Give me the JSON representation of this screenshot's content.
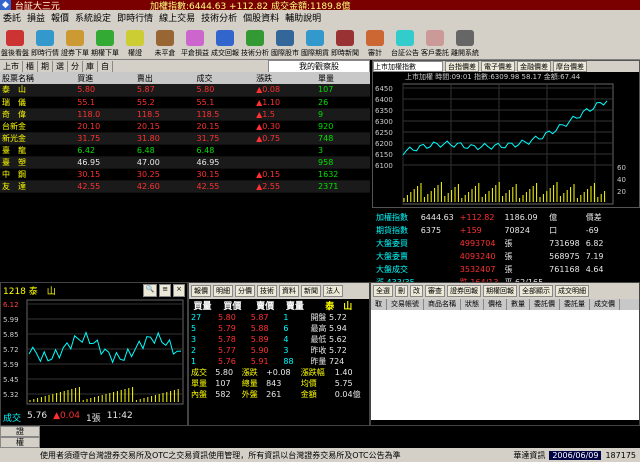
{
  "app": {
    "title": "台証大三元",
    "index_line": "加權指數:6444.63  +112.82 成交金額:1189.8億"
  },
  "menu": [
    "委託",
    "損益",
    "報價",
    "系統設定",
    "即時行情",
    "線上交易",
    "技術分析",
    "個股資料",
    "輔助說明"
  ],
  "toolbar": [
    "盤後看盤",
    "即時行情",
    "證券下單",
    "期權下單",
    "權證",
    "未平倉",
    "平倉損益",
    "成交回報",
    "技術分析",
    "國際股市",
    "國際期貨",
    "即時新聞",
    "審計",
    "台証公告",
    "客戶委託",
    "離開系統"
  ],
  "watch_tabs": [
    "上市",
    "櫃",
    "期",
    "選",
    "分",
    "庫",
    "自"
  ],
  "watchlist_title": "我的觀察股",
  "watch": {
    "headers": [
      "股票名稱",
      "買進",
      "賣出",
      "成交",
      "漲跌",
      "單量"
    ],
    "rows": [
      {
        "name": "泰　山",
        "bid": "5.80",
        "ask": "5.87",
        "last": "5.80",
        "chg": "▲0.08",
        "vol": "107",
        "c": "red"
      },
      {
        "name": "瑞　儀",
        "bid": "55.1",
        "ask": "55.2",
        "last": "55.1",
        "chg": "▲1.10",
        "vol": "26",
        "c": "red"
      },
      {
        "name": "奇　偉",
        "bid": "118.0",
        "ask": "118.5",
        "last": "118.5",
        "chg": "▲1.5",
        "vol": "9",
        "c": "red"
      },
      {
        "name": "台新金",
        "bid": "20.10",
        "ask": "20.15",
        "last": "20.15",
        "chg": "▲0.30",
        "vol": "920",
        "c": "red"
      },
      {
        "name": "新光金",
        "bid": "31.75",
        "ask": "31.80",
        "last": "31.75",
        "chg": "▲0.75",
        "vol": "748",
        "c": "red"
      },
      {
        "name": "臺　龍",
        "bid": "6.42",
        "ask": "6.48",
        "last": "6.48",
        "chg": "",
        "vol": "3",
        "c": "grn"
      },
      {
        "name": "臺　塑",
        "bid": "46.95",
        "ask": "47.00",
        "last": "46.95",
        "chg": "",
        "vol": "958",
        "c": "wht"
      },
      {
        "name": "中　鋼",
        "bid": "30.15",
        "ask": "30.25",
        "last": "30.15",
        "chg": "▲0.15",
        "vol": "1632",
        "c": "red"
      },
      {
        "name": "友　達",
        "bid": "42.55",
        "ask": "42.60",
        "last": "42.55",
        "chg": "▲2.55",
        "vol": "2371",
        "c": "red"
      }
    ]
  },
  "chart": {
    "selector": "上市加權指數",
    "tabs": [
      "台指價差",
      "電子價差",
      "金融價差",
      "摩台價差"
    ],
    "info": "上市加權  時間:09:01 指數:6309.98 58.17 金額:67.44",
    "y_ticks": [
      "6450",
      "6400",
      "6350",
      "6300",
      "6250",
      "6200",
      "6150",
      "6100"
    ],
    "x_ticks": [
      "9",
      "10",
      "11",
      "12",
      "13"
    ],
    "vol_ticks": [
      "60",
      "40",
      "20"
    ]
  },
  "index_panel": [
    {
      "a": "加權指數",
      "b": "6444.63",
      "c": "+112.82",
      "d": "1186.09",
      "e": "億",
      "f": "價差"
    },
    {
      "a": "期貨指數",
      "b": "6375",
      "c": "+159",
      "d": "70824",
      "e": "口",
      "f": "-69"
    },
    {
      "a": "大盤委買",
      "b": "",
      "c": "4993704",
      "d": "張",
      "e": "731698",
      "f": "6.82"
    },
    {
      "a": "大盤委賣",
      "b": "",
      "c": "4093240",
      "d": "張",
      "e": "568975",
      "f": "7.19"
    },
    {
      "a": "大盤成交",
      "b": "",
      "c": "3532407",
      "d": "張",
      "e": "761168",
      "f": "4.64"
    },
    {
      "a": "漲 433/35",
      "b": "",
      "c": "跌 164/13",
      "d": "平 62/165",
      "e": "",
      "f": ""
    }
  ],
  "mini": {
    "code": "1218 泰　山",
    "ticks": [
      "6.12",
      "5.99",
      "5.85",
      "5.72",
      "5.59",
      "5.45",
      "5.32"
    ],
    "x": [
      "9",
      "10",
      "11",
      "12",
      "13"
    ],
    "last": "5.76",
    "chg": "▲0.04",
    "vol": "1張",
    "time": "11:42"
  },
  "quote": {
    "tabs": [
      "報價",
      "明細",
      "分價",
      "技術",
      "資料",
      "新聞",
      "法人"
    ],
    "head": [
      "買量",
      "買價",
      "賣價",
      "賣量"
    ],
    "name": "泰　山",
    "rows": [
      [
        "27",
        "5.80",
        "5.87",
        "1"
      ],
      [
        "5",
        "5.79",
        "5.88",
        "6"
      ],
      [
        "3",
        "5.78",
        "5.89",
        "4"
      ],
      [
        "2",
        "5.77",
        "5.90",
        "3"
      ],
      [
        "1",
        "5.76",
        "5.91",
        "88"
      ]
    ],
    "stats": [
      [
        "開盤",
        "5.72"
      ],
      [
        "最高",
        "5.94"
      ],
      [
        "最低",
        "5.62"
      ],
      [
        "昨收",
        "5.72"
      ],
      [
        "昨量",
        "724"
      ]
    ],
    "bottom": [
      [
        "成交",
        "5.80",
        "漲跌",
        "+0.08",
        "漲跌幅",
        "1.40"
      ],
      [
        "單量",
        "107",
        "總量",
        "843",
        "均價",
        "5.75"
      ],
      [
        "內盤",
        "582",
        "外盤",
        "261",
        "金額",
        "0.04億"
      ]
    ]
  },
  "orders": {
    "tabs": [
      "全選",
      "刪",
      "改",
      "審查",
      "證券回報",
      "期權回報",
      "全部顯示",
      "成交明細"
    ],
    "headers": [
      "取",
      "交易帳號",
      "商品名稱",
      "狀態",
      "價格",
      "數量",
      "委託價",
      "委託量",
      "成交價"
    ]
  },
  "side": [
    "證",
    "權",
    "N"
  ],
  "status": {
    "text": "使用者須遵守台灣證券交易所及OTC之交易資訊使用管理，所有資訊以台灣證券交易所及OTC公告為準",
    "brand": "華達資訊",
    "date": "2006/06/09",
    "clock": "187175"
  }
}
